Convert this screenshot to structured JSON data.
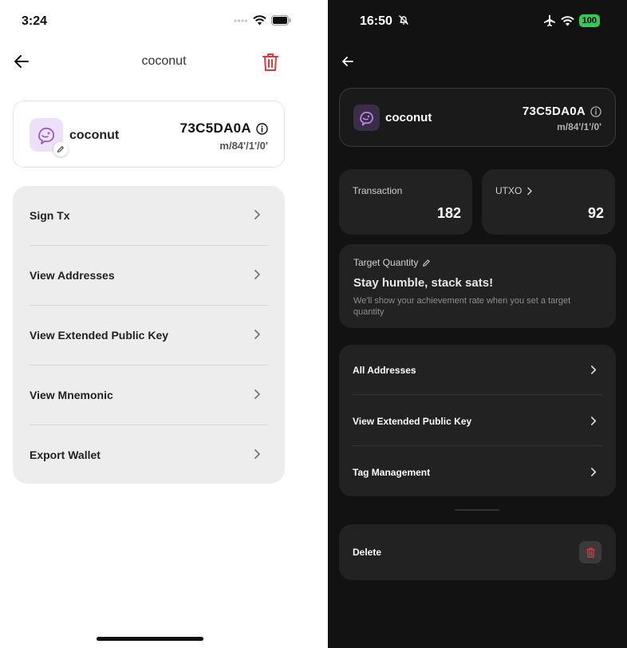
{
  "colors": {
    "accent_red": "#e0383e",
    "avatar_purple": "#9b59c9",
    "dark_bg": "#121212",
    "dark_card": "#222222"
  },
  "light_screen": {
    "status": {
      "time": "3:24"
    },
    "nav": {
      "title": "coconut",
      "back_icon": "arrow-left-icon",
      "delete_icon": "trash-icon"
    },
    "wallet": {
      "name": "coconut",
      "fingerprint": "73C5DA0A",
      "path": "m/84'/1'/0'",
      "avatar_icon": "bird-icon",
      "edit_icon": "pencil-icon",
      "info_icon": "info-icon"
    },
    "menu": [
      {
        "label": "Sign Tx"
      },
      {
        "label": "View Addresses"
      },
      {
        "label": "View Extended Public Key"
      },
      {
        "label": "View Mnemonic"
      },
      {
        "label": "Export Wallet"
      }
    ]
  },
  "dark_screen": {
    "status": {
      "time": "16:50",
      "battery": "100"
    },
    "wallet": {
      "name": "coconut",
      "fingerprint": "73C5DA0A",
      "path": "m/84'/1'/0'"
    },
    "stats": {
      "transaction_label": "Transaction",
      "transaction_count": "182",
      "utxo_label": "UTXO",
      "utxo_count": "92"
    },
    "target": {
      "label": "Target Quantity",
      "slogan": "Stay humble, stack sats!",
      "hint": "We'll show your achievement rate when you set a target quantity"
    },
    "menu": [
      {
        "label": "All Addresses"
      },
      {
        "label": "View Extended Public Key"
      },
      {
        "label": "Tag Management"
      }
    ],
    "delete_label": "Delete"
  }
}
